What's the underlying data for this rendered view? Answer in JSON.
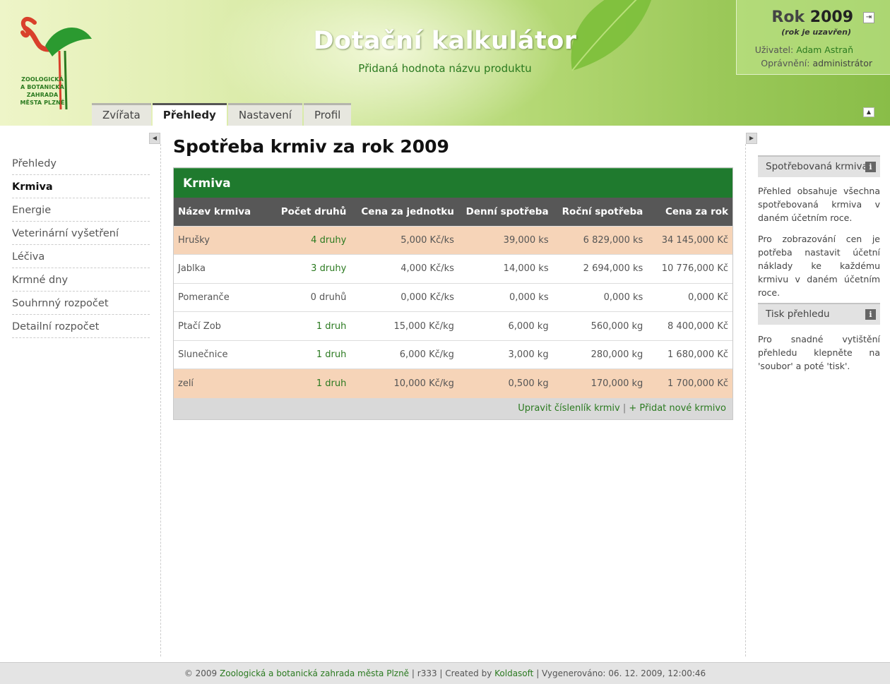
{
  "header": {
    "logo_lines": [
      "ZOOLOGICKÁ",
      "A BOTANICKÁ",
      "ZAHRADA",
      "MĚSTA PLZNĚ"
    ],
    "app_title": "Dotační kalkulátor",
    "app_subtitle": "Přidaná hodnota názvu produktu",
    "tabs": [
      {
        "label": "Zvířata"
      },
      {
        "label": "Přehledy",
        "active": true
      },
      {
        "label": "Nastavení"
      },
      {
        "label": "Profil"
      }
    ]
  },
  "userbox": {
    "year_label": "Rok",
    "year_value": "2009",
    "year_note": "(rok je uzavřen)",
    "user_label": "Uživatel:",
    "user_name": "Adam  Astraň",
    "perm_label": "Oprávnění:",
    "perm_value": "administrátor"
  },
  "leftnav": {
    "items": [
      {
        "label": "Přehledy"
      },
      {
        "label": "Krmiva",
        "active": true
      },
      {
        "label": "Energie"
      },
      {
        "label": "Veterinární vyšetření"
      },
      {
        "label": "Léčiva"
      },
      {
        "label": "Krmné dny"
      },
      {
        "label": "Souhrnný rozpočet"
      },
      {
        "label": "Detailní rozpočet"
      }
    ]
  },
  "main": {
    "page_title": "Spotřeba krmiv za rok 2009",
    "panel_title": "Krmiva",
    "columns": [
      "Název krmiva",
      "Počet druhů",
      "Cena za jednotku",
      "Denní spotřeba",
      "Roční spotřeba",
      "Cena za rok"
    ],
    "rows": [
      {
        "name": "Hrušky",
        "count": "4 druhy",
        "unit_price": "5,000 Kč/ks",
        "daily": "39,000 ks",
        "yearly": "6 829,000 ks",
        "yearly_price": "34 145,000 Kč"
      },
      {
        "name": "Jablka",
        "count": "3 druhy",
        "unit_price": "4,000 Kč/ks",
        "daily": "14,000 ks",
        "yearly": "2 694,000 ks",
        "yearly_price": "10 776,000 Kč"
      },
      {
        "name": "Pomeranče",
        "count": "0 druhů",
        "unit_price": "0,000 Kč/ks",
        "daily": "0,000 ks",
        "yearly": "0,000 ks",
        "yearly_price": "0,000 Kč"
      },
      {
        "name": "Ptačí Zob",
        "count": "1 druh",
        "unit_price": "15,000 Kč/kg",
        "daily": "6,000 kg",
        "yearly": "560,000 kg",
        "yearly_price": "8 400,000 Kč"
      },
      {
        "name": "Slunečnice",
        "count": "1 druh",
        "unit_price": "6,000 Kč/kg",
        "daily": "3,000 kg",
        "yearly": "280,000 kg",
        "yearly_price": "1 680,000 Kč"
      },
      {
        "name": "zelí",
        "count": "1 druh",
        "unit_price": "10,000 Kč/kg",
        "daily": "0,500 kg",
        "yearly": "170,000 kg",
        "yearly_price": "1 700,000 Kč"
      }
    ],
    "footer_link_edit": "Upravit číslenlík krmiv",
    "footer_separator": "|",
    "footer_link_add": "+ Přidat nové krmivo"
  },
  "sidebar": {
    "box1_title": "Spotřebovaná krmiva",
    "box1_text": "Přehled obsahuje všechna spotřebovaná krmiva v daném účetním roce.",
    "box1_text2": "Pro zobrazování cen je potřeba nastavit účetní náklady ke každému krmivu v daném účetním roce.",
    "box2_title": "Tisk přehledu",
    "box2_text": "Pro snadné vytištění přehledu klepněte na 'soubor' a poté 'tisk'."
  },
  "footer": {
    "prefix": "© 2009",
    "org_link": "Zoologická a botanická zahrada města Plzně",
    "revision": "| r333 | Created by",
    "author_link": "Koldasoft",
    "generated": "| Vygenerováno: 06. 12. 2009, 12:00:46"
  },
  "colors": {
    "brand_green": "#1f7a2e",
    "link_green": "#2b7a20",
    "highlight_row": "#f6d4b8",
    "table_header": "#575757"
  },
  "icons": [
    "flamingo-logo",
    "leaf-decoration",
    "logout-icon",
    "collapse-up-icon",
    "arrow-left-icon",
    "arrow-right-icon",
    "info-icon"
  ]
}
